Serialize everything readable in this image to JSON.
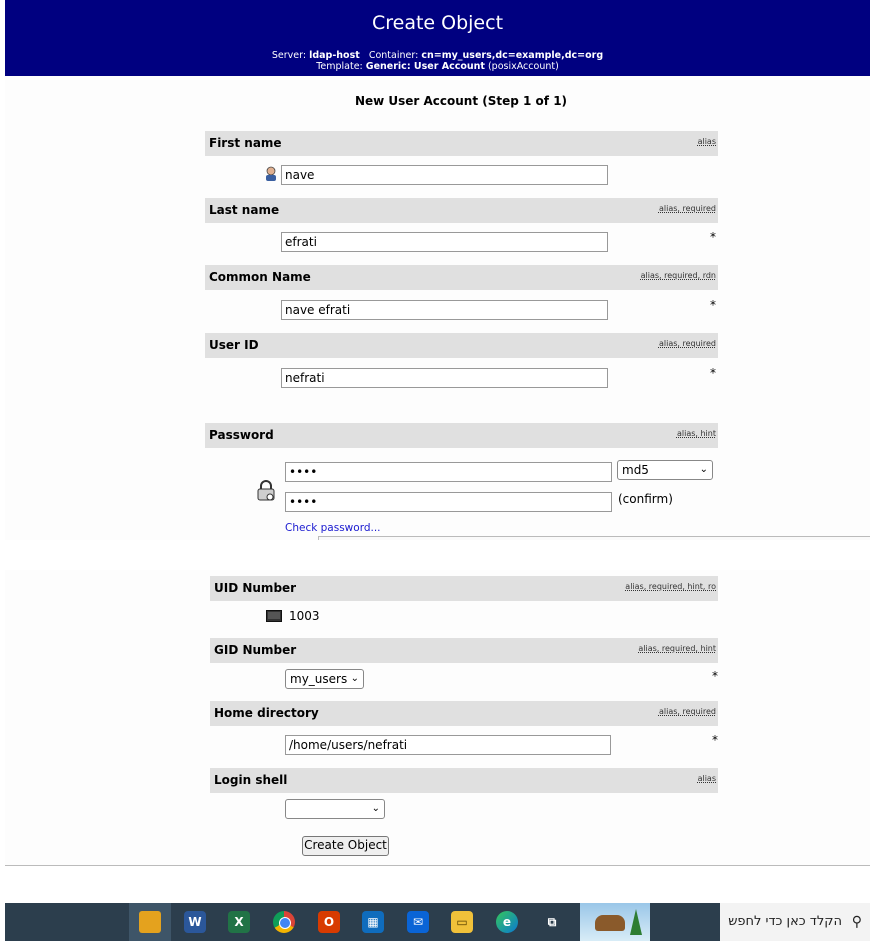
{
  "header": {
    "title": "Create Object",
    "server_label": "Server:",
    "server_value": "ldap-host",
    "container_label": "Container:",
    "container_value": "cn=my_users,dc=example,dc=org",
    "template_label": "Template:",
    "template_value": "Generic: User Account",
    "template_extra": "(posixAccount)"
  },
  "step_title": "New User Account (Step 1 of 1)",
  "fields": {
    "first_name": {
      "label": "First name",
      "hint": "alias",
      "value": "nave"
    },
    "last_name": {
      "label": "Last name",
      "hint": "alias, required",
      "value": "efrati",
      "marker": "*"
    },
    "common_name": {
      "label": "Common Name",
      "hint": "alias, required, rdn",
      "value": "nave efrati",
      "marker": "*"
    },
    "user_id": {
      "label": "User ID",
      "hint": "alias, required",
      "value": "nefrati",
      "marker": "*"
    },
    "password": {
      "label": "Password",
      "hint": "alias, hint",
      "value": "••••",
      "confirm_value": "••••",
      "hash": "md5",
      "confirm_label": "(confirm)",
      "check_link": "Check password..."
    },
    "uid_number": {
      "label": "UID Number",
      "hint": "alias, required, hint, ro",
      "value": "1003"
    },
    "gid_number": {
      "label": "GID Number",
      "hint": "alias, required, hint",
      "value": "my_users",
      "marker": "*"
    },
    "home_directory": {
      "label": "Home directory",
      "hint": "alias, required",
      "value": "/home/users/nefrati",
      "marker": "*"
    },
    "login_shell": {
      "label": "Login shell",
      "hint": "alias",
      "value": ""
    }
  },
  "create_button": "Create Object",
  "taskbar": {
    "icons": [
      "vmware-icon",
      "word-icon",
      "excel-icon",
      "chrome-icon",
      "office-icon",
      "store-icon",
      "mail-icon",
      "explorer-icon",
      "edge-icon",
      "taskview-icon"
    ],
    "search_text": "הקלד כאן כדי לחפש"
  }
}
